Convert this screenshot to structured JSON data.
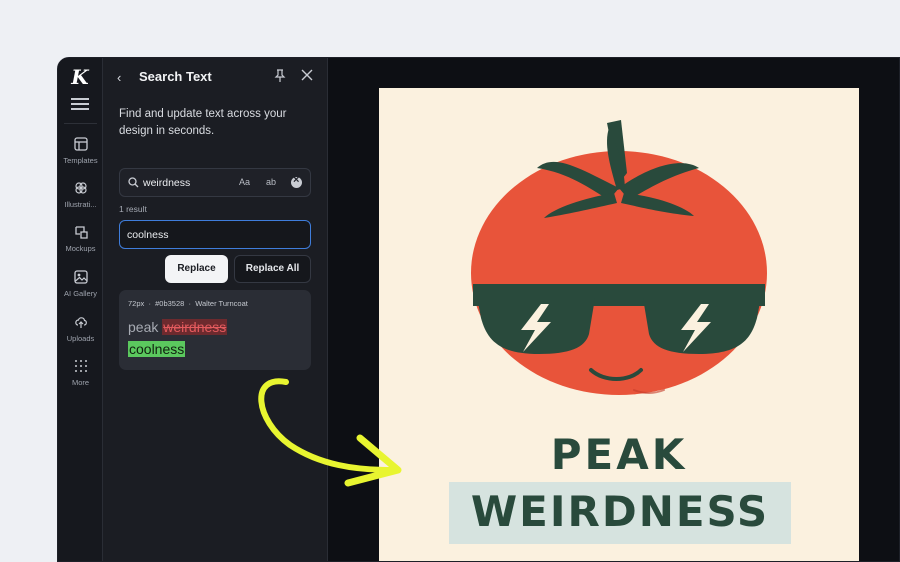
{
  "app": {
    "logo_letter": "K",
    "accent_color": "#3f7ddb",
    "highlight_arrow_color": "#e8f530"
  },
  "rail": {
    "items": [
      {
        "label": "Templates",
        "icon": "layout-icon"
      },
      {
        "label": "Illustrati...",
        "icon": "flower-icon"
      },
      {
        "label": "Mockups",
        "icon": "mockup-icon"
      },
      {
        "label": "AI Gallery",
        "icon": "image-icon"
      },
      {
        "label": "Uploads",
        "icon": "upload-icon"
      },
      {
        "label": "More",
        "icon": "grid-icon"
      }
    ]
  },
  "panel": {
    "title": "Search Text",
    "description": "Find and update text across your design in seconds.",
    "search": {
      "value": "weirdness",
      "match_case_label": "Aa",
      "whole_word_label": "ab"
    },
    "result_count": "1 result",
    "replace_value": "coolness",
    "replace_button": "Replace",
    "replace_all_button": "Replace All",
    "result": {
      "size": "72px",
      "color": "#0b3528",
      "font": "Walter Turncoat",
      "prefix": "peak",
      "removed": "weirdness",
      "added": "coolness"
    }
  },
  "canvas": {
    "headline_line1": "PEAK",
    "headline_line2": "WEIRDNESS",
    "tomato_color": "#e8543a",
    "glasses_color": "#294a3c",
    "background_color": "#fbf1df"
  }
}
